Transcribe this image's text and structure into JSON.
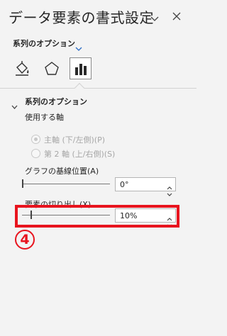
{
  "pane": {
    "title": "データ要素の書式設定",
    "series_dropdown_label": "系列のオプション"
  },
  "tabs": [
    "fill-line",
    "effects",
    "series-options"
  ],
  "section": {
    "title": "系列のオプション",
    "axis_label": "使用する軸",
    "radio_primary": "主軸 (下/左側)(P)",
    "radio_secondary": "第 2 軸 (上/右側)(S)",
    "gap_label": "グラフの基線位置(A)",
    "gap_value": "0°",
    "explosion_label": "要素の切り出し(X)",
    "explosion_value": "10%"
  },
  "annotation": {
    "step": "4",
    "color": "#e8141e"
  }
}
